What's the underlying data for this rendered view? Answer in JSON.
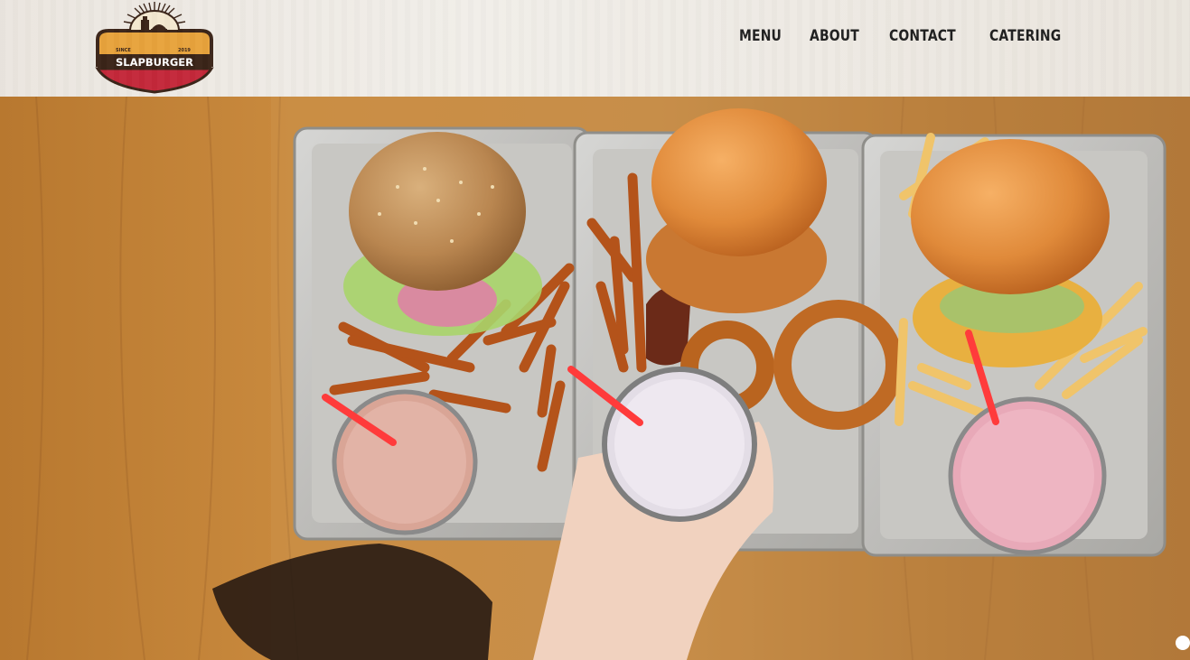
{
  "brand": {
    "name": "SLAPBURGER",
    "since_label": "SINCE",
    "since_year": "2019",
    "colors": {
      "badge_dark": "#3a2418",
      "badge_red": "#c4283a",
      "badge_gold": "#e8a33c"
    }
  },
  "nav": {
    "items": [
      {
        "label": "MENU"
      },
      {
        "label": "ABOUT"
      },
      {
        "label": "CONTACT"
      },
      {
        "label": "CATERING"
      }
    ]
  },
  "hero": {
    "image_description_icon": "burger-trays-photo",
    "slider": {
      "active_index": 1
    }
  },
  "colors": {
    "wood": "#c98a3e",
    "tray": "#c9c9c9",
    "bun": "#e08a3a",
    "straw": "#ff3b3b"
  }
}
